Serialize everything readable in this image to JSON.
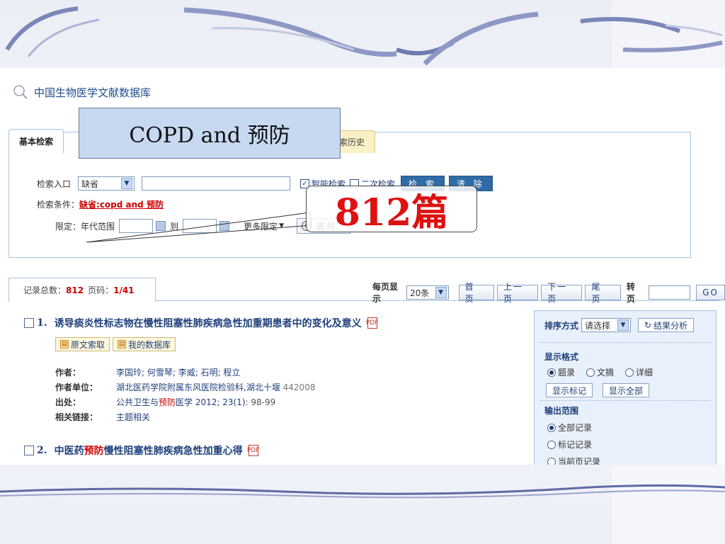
{
  "database": {
    "title": "中国生物医学文献数据库"
  },
  "tabs": {
    "basic": "基本检索",
    "history": "索历史"
  },
  "search": {
    "entry_label": "检索入口",
    "entry_value": "缺省",
    "smart_label": "智能检索",
    "secondary_label": "二次检索",
    "search_button": "检 索",
    "clear_button": "清 除",
    "condition_label": "检索条件：",
    "condition_value": "缺省:copd and 预防",
    "limit_label": "限定：",
    "year_range_label": "年代范围",
    "to_label": "到",
    "more_limits": "更多限定",
    "limit_clear": "清 除"
  },
  "results": {
    "total_label": "记录总数：",
    "total": "812",
    "page_label": "页码：",
    "page": "1/41",
    "per_page_label": "每页显示",
    "per_page_value": "20条",
    "first_page": "首 页",
    "prev_page": "上一页",
    "next_page": "下一页",
    "last_page": "尾 页",
    "goto_label": "转页",
    "go_button": "GO"
  },
  "items": [
    {
      "num": "1.",
      "title": "诱导痰炎性标志物在慢性阻塞性肺疾病急性加重期患者中的变化及意义",
      "btn_fulltext": "原文索取",
      "btn_mydb": "我的数据库",
      "author_key": "作者：",
      "author_val": "李国玲; 何雪琴; 李威; 石明; 程立",
      "unit_key": "作者单位：",
      "unit_val": "湖北医药学院附属东风医院检验科,湖北十堰",
      "unit_zip": "442008",
      "source_key": "出处：",
      "source_pre": "公共卫生与",
      "source_red": "预防",
      "source_mid": "医学 2012; 23(1)",
      "source_pages": ": 98-99",
      "related_key": "相关链接：",
      "related_val": "主题相关"
    },
    {
      "num": "2.",
      "title_pre": "中医药",
      "title_red": "预防",
      "title_post": "慢性阻塞性肺疾病急性加重心得"
    }
  ],
  "side": {
    "sort_label": "排序方式",
    "sort_value": "请选择",
    "analysis_button": "结果分析",
    "format_label": "显示格式",
    "format_options": [
      "题录",
      "文摘",
      "详细"
    ],
    "show_marked": "显示标记",
    "show_all": "显示全部",
    "output_label": "输出范围",
    "output_options": [
      "全部记录",
      "标记记录",
      "当前页记录"
    ]
  },
  "overlay": {
    "query_callout": "COPD and 预防",
    "count_callout": "812篇"
  }
}
